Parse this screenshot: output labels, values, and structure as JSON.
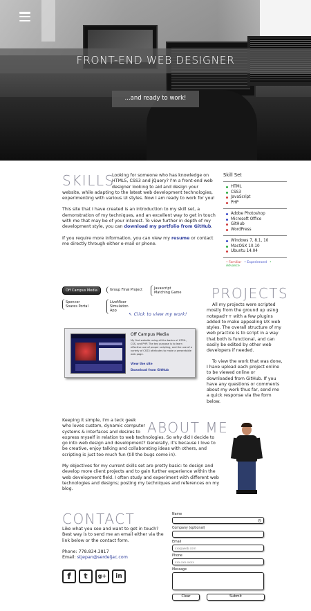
{
  "hero": {
    "title": "FRONT-END WEB DESIGNER",
    "subtitle": "...and ready to work!"
  },
  "skills": {
    "title": "SKILLS",
    "p1": "Looking for someone who has knowledge on HTML5, CSS3 and jQuery? I'm a front-end web designer looking to aid and design your website, while adapting to the latest web development technologies, experimenting with various UI styles. Now I am ready to work for you!",
    "p2_pre": "This site that I have created is an introduction to my skill set, a demonstration of my techniques, and an excellent way to get in touch with me that may be of your interest. To view further in depth of my development style, you can ",
    "p2_link": "download my portfolio from GitHub",
    "p2_post": ".",
    "p3_pre": "If you require more information, you can view my ",
    "p3_link": "resume",
    "p3_post": " or contact me directly through either e-mail or phone."
  },
  "skillset": {
    "heading": "Skill Set",
    "groups": [
      [
        {
          "label": "HTML",
          "color": "#2eae43"
        },
        {
          "label": "CSS3",
          "color": "#2eae43"
        },
        {
          "label": "JavaScript",
          "color": "#d03c3c"
        },
        {
          "label": "PHP",
          "color": "#d03c3c"
        }
      ],
      [
        {
          "label": "Adobe Photoshop",
          "color": "#3a4ac8"
        },
        {
          "label": "Microsoft Office",
          "color": "#3a4ac8"
        },
        {
          "label": "GitHub",
          "color": "#d03c3c"
        },
        {
          "label": "WordPress",
          "color": "#d03c3c"
        }
      ],
      [
        {
          "label": "Windows 7, 8.1, 10",
          "color": "#3a4ac8"
        },
        {
          "label": "MacOSX 10.10",
          "color": "#2eae43"
        },
        {
          "label": "Ubuntu 14.04",
          "color": "#d03c3c"
        }
      ]
    ],
    "legend": [
      {
        "label": "Familiar",
        "color": "#d03c3c"
      },
      {
        "label": "Experienced",
        "color": "#3a4ac8"
      },
      {
        "label": "Advance",
        "color": "#2eae43"
      }
    ]
  },
  "projects": {
    "title": "PROJECTS",
    "tabs": [
      {
        "label": "Off Campus Media",
        "active": true
      },
      {
        "label": "Group Final Project",
        "active": false
      },
      {
        "label": "Javascript Matching Game",
        "active": false
      },
      {
        "label": "Spencer Soares Portal",
        "active": false
      },
      {
        "label": "LiveMixer Simulation App",
        "active": false
      }
    ],
    "click_note": "Click to view my work!",
    "card": {
      "name": "Off Campus Media",
      "description": "My first website using all the basics of HTML, CSS, and PHP. The key purpose is to learn effective use of proper scripting, and the use of a variety of CSS3 attributes to make a presentable web page.",
      "view_site": "View the site",
      "download": "Download from GitHub"
    },
    "p1": "All my projects were scripted mostly from the ground up using notepad++ with a few plugins added to make appealing UX web styles. The overall structure of my web practice is to script in a way that both is functional, and can easily be edited by other web developers if needed.",
    "p2": "To view the work that was done, I have upload each project online to be viewed online or downloaded from GitHub. If you have any questions or comments about my work thus far, send me a quick response via the form below."
  },
  "about": {
    "title": "ABOUT ME",
    "p1": "Keeping it simple, I'm a teck geek who loves custom, dynamic computer systems & interfaces and desires to express myself in relation to web technologies. So why did I decide to go into web design and development? Generally, it's because I love to be creative, enjoy talking and collaborating ideas with others, and scripting is just too much fun (till the bugs come in).",
    "p2": "My objectives for my current skills set are pretty basic: to design and develop more client projects and to gain further experience within the web development field. I often study and experiment with different web technologies and designs; posting my techniques and references on my blog."
  },
  "contact": {
    "title": "CONTACT",
    "p1": "Like what you see and want to get in touch? Best way is to send me an email either via the link below or the contact form.",
    "phone": "Phone: 778.834.3817",
    "email_label": "Email: ",
    "email": "stjepan@serdeljac.com",
    "socials": [
      "facebook-icon",
      "twitter-icon",
      "googleplus-icon",
      "linkedin-icon"
    ],
    "form": {
      "name_label": "Name",
      "company_label": "Company (optional)",
      "email_label": "Email",
      "email_placeholder": "xxx@web.com",
      "phone_label": "Phone",
      "phone_placeholder": "xxx-xxx-xxxx",
      "message_label": "Message",
      "clear": "Clear",
      "submit": "Submit"
    }
  }
}
